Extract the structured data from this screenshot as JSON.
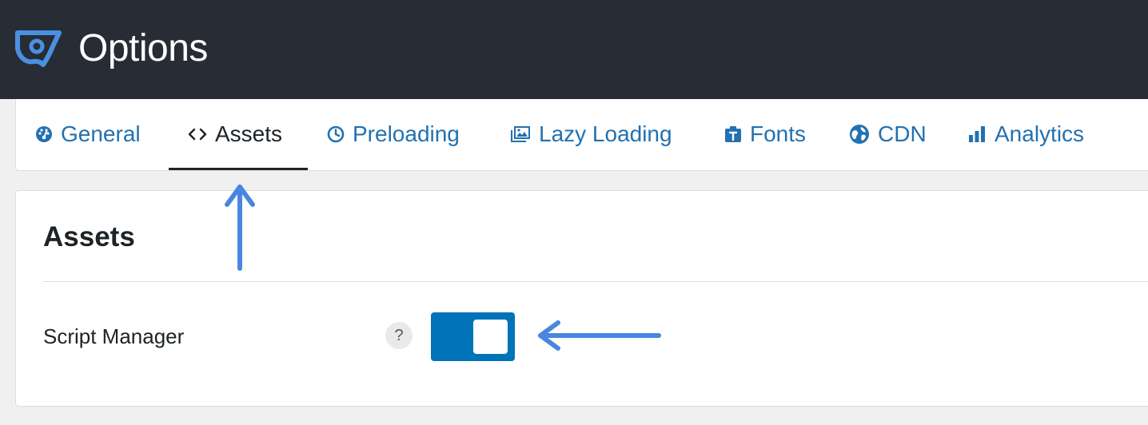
{
  "header": {
    "title": "Options",
    "logo_icon": "perfmatters-logo-icon",
    "background": "#282c34",
    "logo_color": "#4a90e2"
  },
  "tabs": [
    {
      "label": "General",
      "icon": "dashboard-icon",
      "active": false
    },
    {
      "label": "Assets",
      "icon": "code-icon",
      "active": true
    },
    {
      "label": "Preloading",
      "icon": "clock-icon",
      "active": false
    },
    {
      "label": "Lazy Loading",
      "icon": "images-icon",
      "active": false
    },
    {
      "label": "Fonts",
      "icon": "font-icon",
      "active": false
    },
    {
      "label": "CDN",
      "icon": "globe-icon",
      "active": false
    },
    {
      "label": "Analytics",
      "icon": "bar-chart-icon",
      "active": false
    }
  ],
  "section": {
    "title": "Assets",
    "settings": [
      {
        "label": "Script Manager",
        "help": "?",
        "enabled": true
      }
    ]
  },
  "colors": {
    "link": "#2271b1",
    "toggle_on": "#0073b9",
    "annotation_arrow": "#4a86e0"
  }
}
